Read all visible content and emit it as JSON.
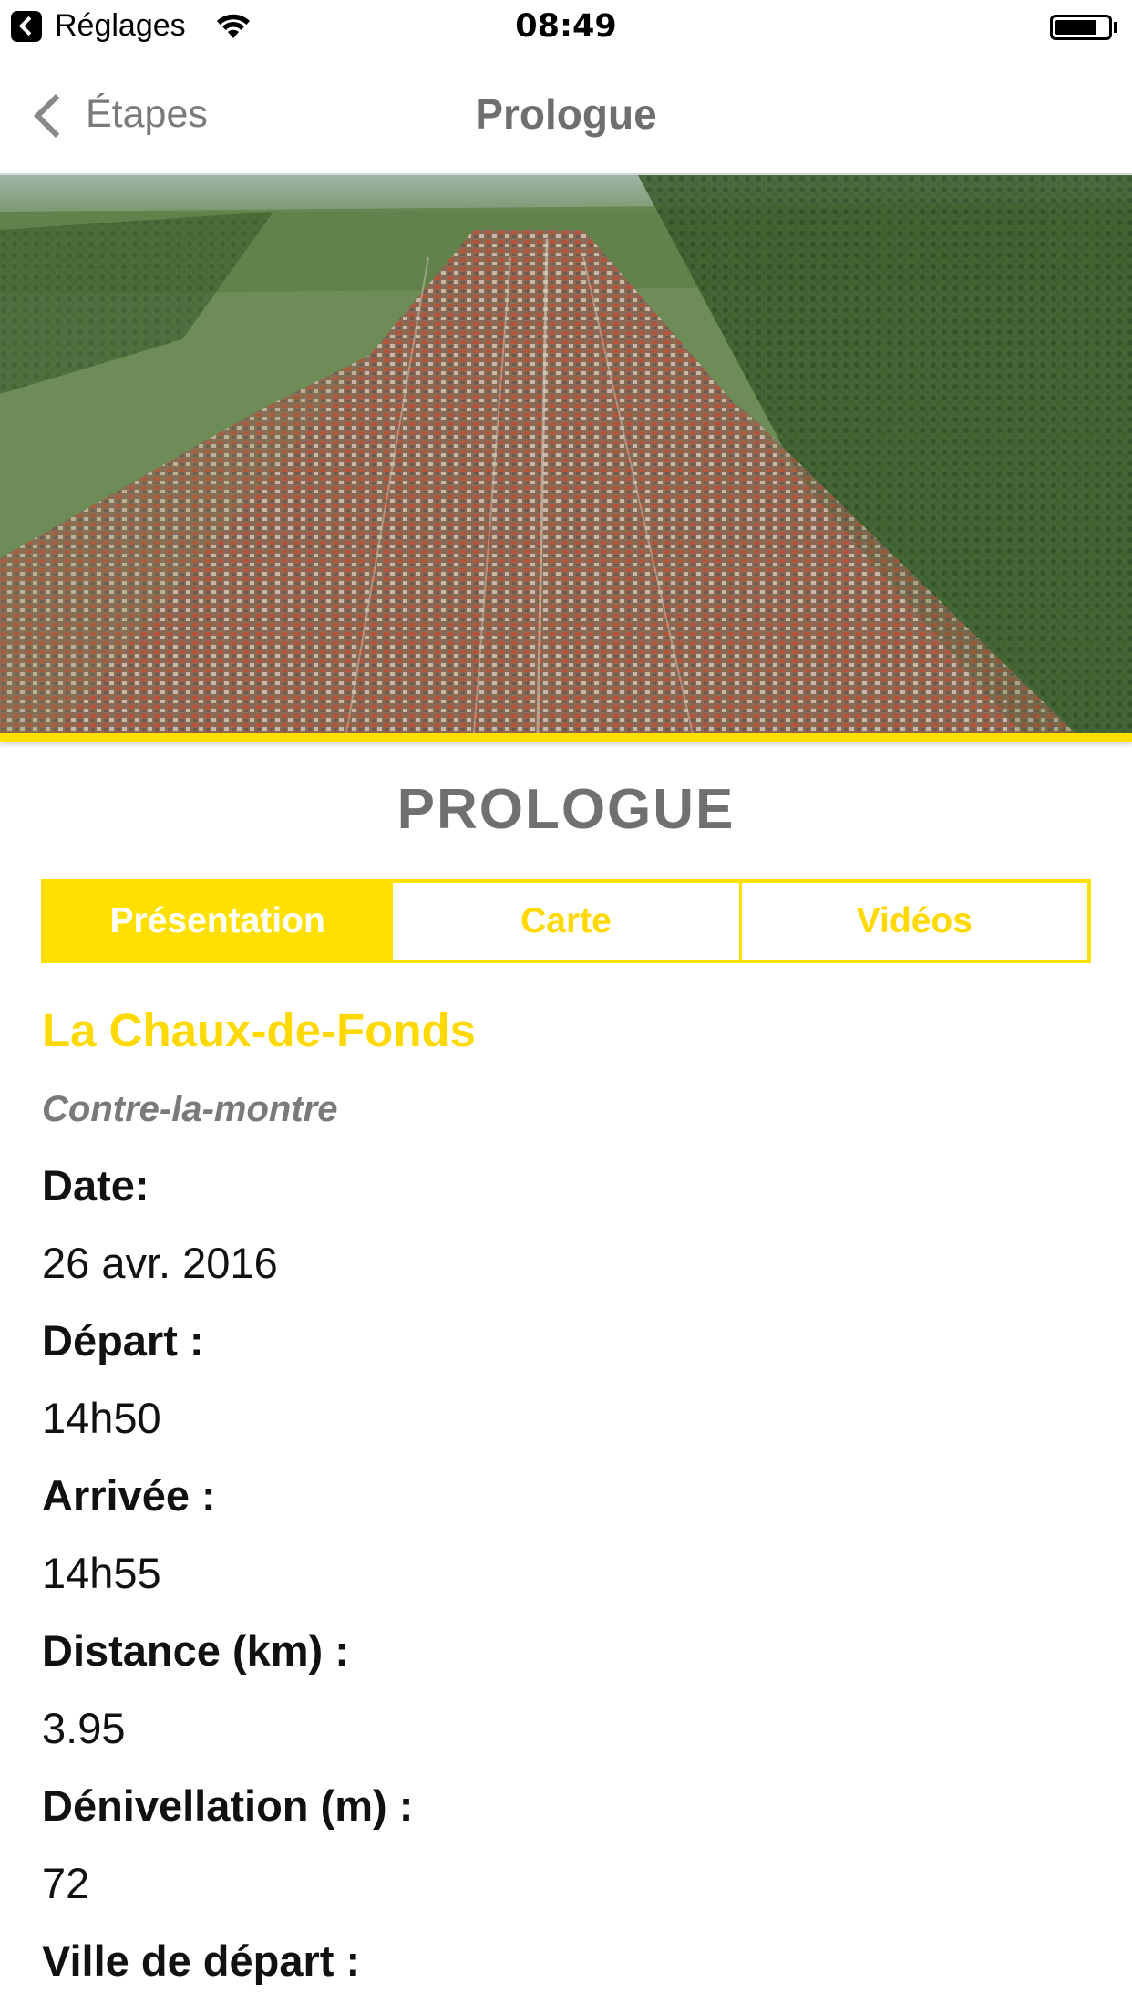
{
  "status_bar": {
    "app_back": "Réglages",
    "time": "08:49"
  },
  "nav": {
    "back_label": "Étapes",
    "title": "Prologue"
  },
  "stage": {
    "heading": "PROLOGUE",
    "tabs": [
      {
        "label": "Présentation",
        "active": true
      },
      {
        "label": "Carte",
        "active": false
      },
      {
        "label": "Vidéos",
        "active": false
      }
    ],
    "location": "La Chaux-de-Fonds",
    "type": "Contre-la-montre",
    "fields": [
      {
        "label": "Date:",
        "value": "26 avr. 2016"
      },
      {
        "label": "Départ :",
        "value": "14h50"
      },
      {
        "label": "Arrivée :",
        "value": "14h55"
      },
      {
        "label": "Distance (km) :",
        "value": "3.95"
      },
      {
        "label": "Dénivellation (m) :",
        "value": "72"
      },
      {
        "label": "Ville de départ :",
        "value": ""
      }
    ]
  },
  "colors": {
    "accent": "#ffe000",
    "nav_text": "#7a7a7a"
  }
}
